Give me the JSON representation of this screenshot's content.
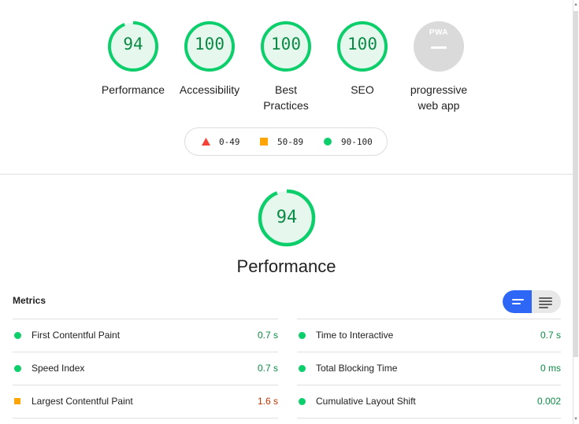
{
  "summary": {
    "categories": [
      {
        "id": "performance",
        "score": "94",
        "score_value": 94,
        "label": "Performance"
      },
      {
        "id": "accessibility",
        "score": "100",
        "score_value": 100,
        "label": "Accessibility"
      },
      {
        "id": "best-practices",
        "score": "100",
        "score_value": 100,
        "label": "Best Practices"
      },
      {
        "id": "seo",
        "score": "100",
        "score_value": 100,
        "label": "SEO"
      },
      {
        "id": "pwa",
        "badge": "PWA",
        "label": "progressive web app"
      }
    ]
  },
  "legend": {
    "items": [
      {
        "range": "0-49",
        "shape": "triangle",
        "color": "#f44336"
      },
      {
        "range": "50-89",
        "shape": "square",
        "color": "#ffa400"
      },
      {
        "range": "90-100",
        "shape": "circle",
        "color": "#0cce6b"
      }
    ]
  },
  "performance": {
    "score": "94",
    "score_value": 94,
    "title": "Performance",
    "metrics_heading": "Metrics",
    "view_toggle": {
      "active": "compact-view-icon",
      "inactive": "expanded-view-icon"
    },
    "metrics_left": [
      {
        "name": "First Contentful Paint",
        "value": "0.7 s",
        "rating": "pass"
      },
      {
        "name": "Speed Index",
        "value": "0.7 s",
        "rating": "pass"
      },
      {
        "name": "Largest Contentful Paint",
        "value": "1.6 s",
        "rating": "average"
      }
    ],
    "metrics_right": [
      {
        "name": "Time to Interactive",
        "value": "0.7 s",
        "rating": "pass"
      },
      {
        "name": "Total Blocking Time",
        "value": "0 ms",
        "rating": "pass"
      },
      {
        "name": "Cumulative Layout Shift",
        "value": "0.002",
        "rating": "pass"
      }
    ]
  },
  "colors": {
    "pass": "#0cce6b",
    "pass_text": "#0a8a44",
    "average": "#ffa400",
    "average_text": "#c33300",
    "fail": "#f44336",
    "gauge_fill": "#e6f8ee",
    "pwa_gray": "#dadada",
    "toggle_active": "#2e66f5"
  }
}
